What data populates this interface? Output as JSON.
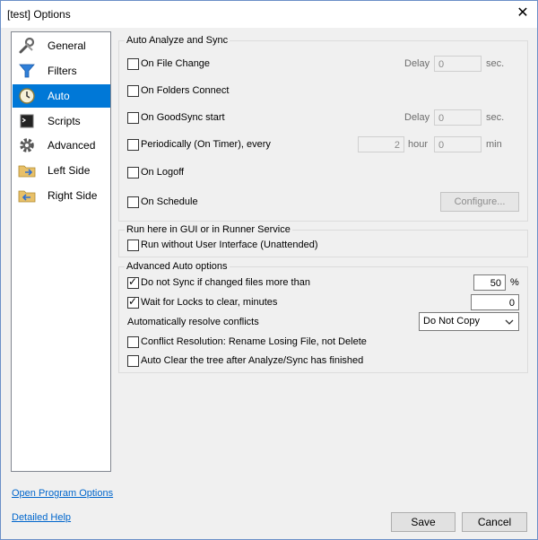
{
  "window": {
    "title": "[test] Options",
    "close_glyph": "✕"
  },
  "sidebar": {
    "items": [
      {
        "label": "General",
        "icon": "wrench-icon"
      },
      {
        "label": "Filters",
        "icon": "filter-icon"
      },
      {
        "label": "Auto",
        "icon": "clock-icon",
        "selected": true
      },
      {
        "label": "Scripts",
        "icon": "script-icon"
      },
      {
        "label": "Advanced",
        "icon": "gear-icon"
      },
      {
        "label": "Left Side",
        "icon": "folder-left-icon"
      },
      {
        "label": "Right Side",
        "icon": "folder-right-icon"
      }
    ]
  },
  "auto_sync": {
    "title": "Auto Analyze and Sync",
    "on_file_change": {
      "label": "On File Change",
      "checked": false,
      "delay_label": "Delay",
      "delay_value": "0",
      "unit": "sec."
    },
    "on_folders_connect": {
      "label": "On Folders Connect",
      "checked": false
    },
    "on_goodsync_start": {
      "label": "On GoodSync start",
      "checked": false,
      "delay_label": "Delay",
      "delay_value": "0",
      "unit": "sec."
    },
    "periodically": {
      "label": "Periodically (On Timer), every",
      "checked": false,
      "hour_value": "2",
      "hour_label": "hour",
      "min_value": "0",
      "min_label": "min"
    },
    "on_logoff": {
      "label": "On Logoff",
      "checked": false
    },
    "on_schedule": {
      "label": "On Schedule",
      "checked": false,
      "configure_label": "Configure..."
    }
  },
  "runner": {
    "title": "Run here in GUI or in Runner Service",
    "unattended": {
      "label": "Run without User Interface (Unattended)",
      "checked": false
    }
  },
  "advanced_auto": {
    "title": "Advanced Auto options",
    "do_not_sync": {
      "label": "Do not Sync if changed files more than",
      "checked": true,
      "value": "50",
      "unit": "%"
    },
    "wait_locks": {
      "label": "Wait for Locks to clear, minutes",
      "checked": true,
      "value": "0"
    },
    "resolve_conflicts": {
      "label": "Automatically resolve conflicts",
      "selected": "Do Not Copy"
    },
    "conflict_rename": {
      "label": "Conflict Resolution: Rename Losing File, not Delete",
      "checked": false
    },
    "auto_clear": {
      "label": "Auto Clear the tree after Analyze/Sync has finished",
      "checked": false
    }
  },
  "footer": {
    "open_program_options": "Open Program Options",
    "detailed_help": "Detailed Help",
    "save_label": "Save",
    "cancel_label": "Cancel"
  },
  "colors": {
    "selection": "#0078d7",
    "link": "#0066cc",
    "dialog_bg": "#f0f0f0"
  }
}
